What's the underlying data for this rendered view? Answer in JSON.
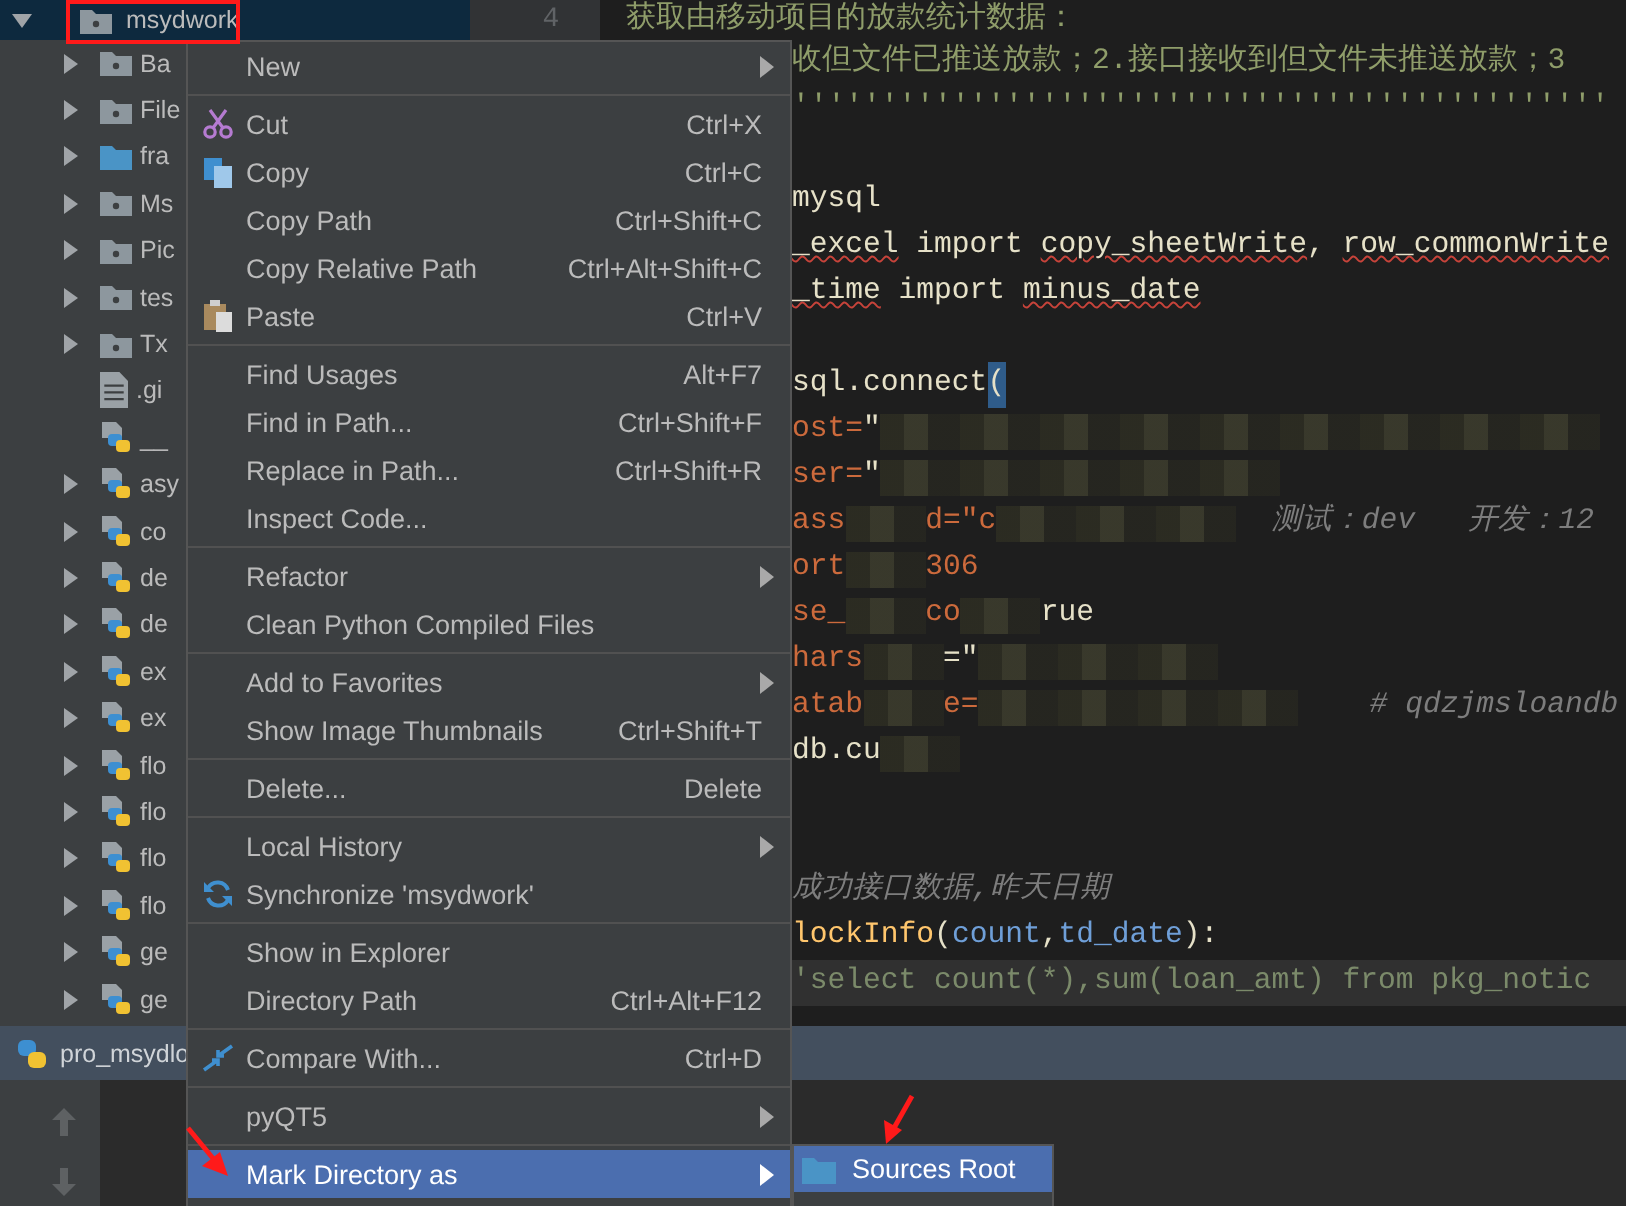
{
  "tree": {
    "root": {
      "label": "msydwork",
      "expanded": true,
      "selected": true,
      "children": [
        {
          "label": "Ba",
          "kind": "package",
          "expandable": true
        },
        {
          "label": "File",
          "kind": "package",
          "expandable": true
        },
        {
          "label": "fra",
          "kind": "folder",
          "expandable": true
        },
        {
          "label": "Ms",
          "kind": "package",
          "expandable": true
        },
        {
          "label": "Pic",
          "kind": "package",
          "expandable": true
        },
        {
          "label": "tes",
          "kind": "package",
          "expandable": true
        },
        {
          "label": "Tx",
          "kind": "package",
          "expandable": true
        },
        {
          "label": ".gi",
          "kind": "text-file",
          "expandable": false
        },
        {
          "label": "__",
          "kind": "python",
          "expandable": false
        },
        {
          "label": "asy",
          "kind": "python",
          "expandable": true
        },
        {
          "label": "co",
          "kind": "python",
          "expandable": true
        },
        {
          "label": "de",
          "kind": "python",
          "expandable": true
        },
        {
          "label": "de",
          "kind": "python",
          "expandable": true
        },
        {
          "label": "ex",
          "kind": "python",
          "expandable": true
        },
        {
          "label": "ex",
          "kind": "python",
          "expandable": true
        },
        {
          "label": "flo",
          "kind": "python",
          "expandable": true
        },
        {
          "label": "flo",
          "kind": "python",
          "expandable": true
        },
        {
          "label": "flo",
          "kind": "python",
          "expandable": true
        },
        {
          "label": "flo",
          "kind": "python",
          "expandable": true
        },
        {
          "label": "ge",
          "kind": "python",
          "expandable": true
        },
        {
          "label": "ge",
          "kind": "python",
          "expandable": true
        }
      ]
    }
  },
  "editor": {
    "line_number": "4",
    "lines": [
      {
        "current": false,
        "segments": [
          {
            "text": "获取由移动项目的放款统计数据：",
            "kind": "docstring"
          }
        ]
      },
      {
        "current": false,
        "segments": [
          {
            "text": "收但文件已推送放款；2.接口接收到但文件未推送放款；3",
            "kind": "docstring"
          }
        ]
      },
      {
        "current": false,
        "segments": [
          {
            "text": "''''''''''''''''''''''''''''''''''''''''''''''",
            "kind": "docstring"
          }
        ]
      },
      {
        "current": false
      },
      {
        "current": false,
        "segments": [
          {
            "text": "mysql",
            "kind": "plain"
          }
        ]
      },
      {
        "current": false,
        "segments": [
          {
            "text": "_excel",
            "kind": "unresolved"
          },
          {
            "text": " import ",
            "kind": "plain"
          },
          {
            "text": "copy_sheetWrite",
            "kind": "unresolved"
          },
          {
            "text": ", ",
            "kind": "plain"
          },
          {
            "text": "row_commonWrite",
            "kind": "unresolved"
          }
        ]
      },
      {
        "current": false,
        "segments": [
          {
            "text": "_time",
            "kind": "unresolved"
          },
          {
            "text": " import ",
            "kind": "plain"
          },
          {
            "text": "minus_date",
            "kind": "unresolved"
          }
        ]
      },
      {
        "current": false
      },
      {
        "current": false,
        "segments": [
          {
            "text": "sql.connect",
            "kind": "plain"
          },
          {
            "text": "(",
            "kind": "brace"
          }
        ]
      },
      {
        "current": false,
        "segments": [
          {
            "text": "ost=",
            "kind": "param"
          },
          {
            "text": "\"",
            "kind": "plain"
          },
          {
            "kind": "blur"
          },
          {
            "kind": "blur"
          },
          {
            "kind": "blur"
          },
          {
            "kind": "blur"
          },
          {
            "kind": "blur"
          },
          {
            "kind": "blur"
          },
          {
            "kind": "blur"
          },
          {
            "kind": "blur"
          },
          {
            "kind": "blur"
          }
        ]
      },
      {
        "current": false,
        "segments": [
          {
            "text": "ser=",
            "kind": "param"
          },
          {
            "text": "\"",
            "kind": "plain"
          },
          {
            "kind": "blur"
          },
          {
            "kind": "blur"
          },
          {
            "kind": "blur"
          },
          {
            "kind": "blur"
          },
          {
            "kind": "blur"
          }
        ]
      },
      {
        "current": false,
        "segments": [
          {
            "text": "ass",
            "kind": "param"
          },
          {
            "kind": "blur"
          },
          {
            "text": "d=\"c",
            "kind": "param"
          },
          {
            "kind": "blur"
          },
          {
            "kind": "blur"
          },
          {
            "kind": "blur"
          },
          {
            "text": "  测试：dev   开发：12",
            "kind": "comment"
          }
        ]
      },
      {
        "current": false,
        "segments": [
          {
            "text": "ort",
            "kind": "param"
          },
          {
            "kind": "blur"
          },
          {
            "text": "306",
            "kind": "param"
          }
        ]
      },
      {
        "current": false,
        "segments": [
          {
            "text": "se_",
            "kind": "param"
          },
          {
            "kind": "blur"
          },
          {
            "text": "co",
            "kind": "param"
          },
          {
            "kind": "blur"
          },
          {
            "text": "rue",
            "kind": "plain"
          }
        ]
      },
      {
        "current": false,
        "segments": [
          {
            "text": "hars",
            "kind": "param"
          },
          {
            "kind": "blur"
          },
          {
            "text": "=\"",
            "kind": "plain"
          },
          {
            "kind": "blur"
          },
          {
            "kind": "blur"
          },
          {
            "kind": "blur"
          }
        ]
      },
      {
        "current": false,
        "segments": [
          {
            "text": "atab",
            "kind": "param"
          },
          {
            "kind": "blur"
          },
          {
            "text": "e=",
            "kind": "param"
          },
          {
            "kind": "blur"
          },
          {
            "kind": "blur"
          },
          {
            "kind": "blur"
          },
          {
            "kind": "blur"
          },
          {
            "text": "    # qdzjmsloandb",
            "kind": "comment"
          }
        ]
      },
      {
        "current": false,
        "segments": [
          {
            "text": "db.cu",
            "kind": "plain"
          },
          {
            "kind": "blur"
          }
        ]
      },
      {
        "current": false
      },
      {
        "current": false
      },
      {
        "current": false,
        "segments": [
          {
            "text": "成功接口数据,昨天日期",
            "kind": "comment"
          }
        ]
      },
      {
        "current": false,
        "segments": [
          {
            "text": "lockInfo",
            "kind": "function"
          },
          {
            "text": "(",
            "kind": "plain"
          },
          {
            "text": "count",
            "kind": "argument"
          },
          {
            "text": ",",
            "kind": "plain"
          },
          {
            "text": "td_date",
            "kind": "argument"
          },
          {
            "text": "):",
            "kind": "plain"
          }
        ]
      },
      {
        "current": true,
        "segments": [
          {
            "text": "'select count(*),sum(loan_amt) from pkg_notic",
            "kind": "string"
          }
        ]
      }
    ]
  },
  "context_menu": {
    "groups": [
      {
        "items": [
          {
            "label": "New",
            "submenu": true,
            "selected": false
          }
        ]
      },
      {
        "items": [
          {
            "label": "Cut",
            "shortcut": "Ctrl+X",
            "submenu": false,
            "selected": false
          },
          {
            "label": "Copy",
            "shortcut": "Ctrl+C",
            "submenu": false,
            "selected": false
          },
          {
            "label": "Copy Path",
            "shortcut": "Ctrl+Shift+C",
            "submenu": false,
            "selected": false
          },
          {
            "label": "Copy Relative Path",
            "shortcut": "Ctrl+Alt+Shift+C",
            "submenu": false,
            "selected": false
          },
          {
            "label": "Paste",
            "shortcut": "Ctrl+V",
            "submenu": false,
            "selected": false
          }
        ]
      },
      {
        "items": [
          {
            "label": "Find Usages",
            "shortcut": "Alt+F7",
            "submenu": false,
            "selected": false
          },
          {
            "label": "Find in Path...",
            "shortcut": "Ctrl+Shift+F",
            "submenu": false,
            "selected": false
          },
          {
            "label": "Replace in Path...",
            "shortcut": "Ctrl+Shift+R",
            "submenu": false,
            "selected": false
          },
          {
            "label": "Inspect Code...",
            "submenu": false,
            "selected": false
          }
        ]
      },
      {
        "items": [
          {
            "label": "Refactor",
            "submenu": true,
            "selected": false
          },
          {
            "label": "Clean Python Compiled Files",
            "submenu": false,
            "selected": false
          }
        ]
      },
      {
        "items": [
          {
            "label": "Add to Favorites",
            "submenu": true,
            "selected": false
          },
          {
            "label": "Show Image Thumbnails",
            "shortcut": "Ctrl+Shift+T",
            "submenu": false,
            "selected": false
          }
        ]
      },
      {
        "items": [
          {
            "label": "Delete...",
            "shortcut": "Delete",
            "submenu": false,
            "selected": false
          }
        ]
      },
      {
        "items": [
          {
            "label": "Local History",
            "submenu": true,
            "selected": false
          },
          {
            "label": "Synchronize 'msydwork'",
            "submenu": false,
            "selected": false
          }
        ]
      },
      {
        "items": [
          {
            "label": "Show in Explorer",
            "submenu": false,
            "selected": false
          },
          {
            "label": "Directory Path",
            "shortcut": "Ctrl+Alt+F12",
            "submenu": false,
            "selected": false
          }
        ]
      },
      {
        "items": [
          {
            "label": "Compare With...",
            "shortcut": "Ctrl+D",
            "submenu": false,
            "selected": false
          }
        ]
      },
      {
        "items": [
          {
            "label": "pyQT5",
            "submenu": true,
            "selected": false
          }
        ]
      },
      {
        "items": [
          {
            "label": "Mark Directory as",
            "submenu": true,
            "selected": true
          }
        ]
      }
    ]
  },
  "submenu": {
    "items": [
      {
        "label": "Sources Root",
        "selected": true
      }
    ]
  },
  "run_bar": {
    "title": "pro_msydlo"
  }
}
